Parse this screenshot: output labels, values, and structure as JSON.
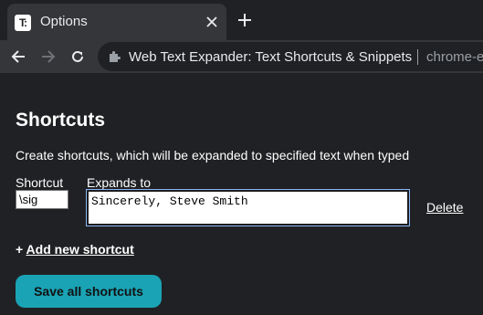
{
  "browser": {
    "tab_title": "Options",
    "tab_favicon_text": "T‑",
    "omnibox_site": "Web Text Expander: Text Shortcuts & Snippets",
    "omnibox_url": "chrome-e"
  },
  "page": {
    "title": "Shortcuts",
    "description": "Create shortcuts, which will be expanded to specified text when typed",
    "shortcut_label": "Shortcut",
    "expands_label": "Expands to",
    "shortcut_value": "\\sig",
    "expands_value": "Sincerely, Steve Smith",
    "delete_label": "Delete",
    "add_prefix": "+ ",
    "add_label": "Add new shortcut",
    "save_label": "Save all shortcuts"
  },
  "colors": {
    "accent": "#1aa3b5",
    "background": "#202124",
    "toolbar": "#35363a"
  }
}
